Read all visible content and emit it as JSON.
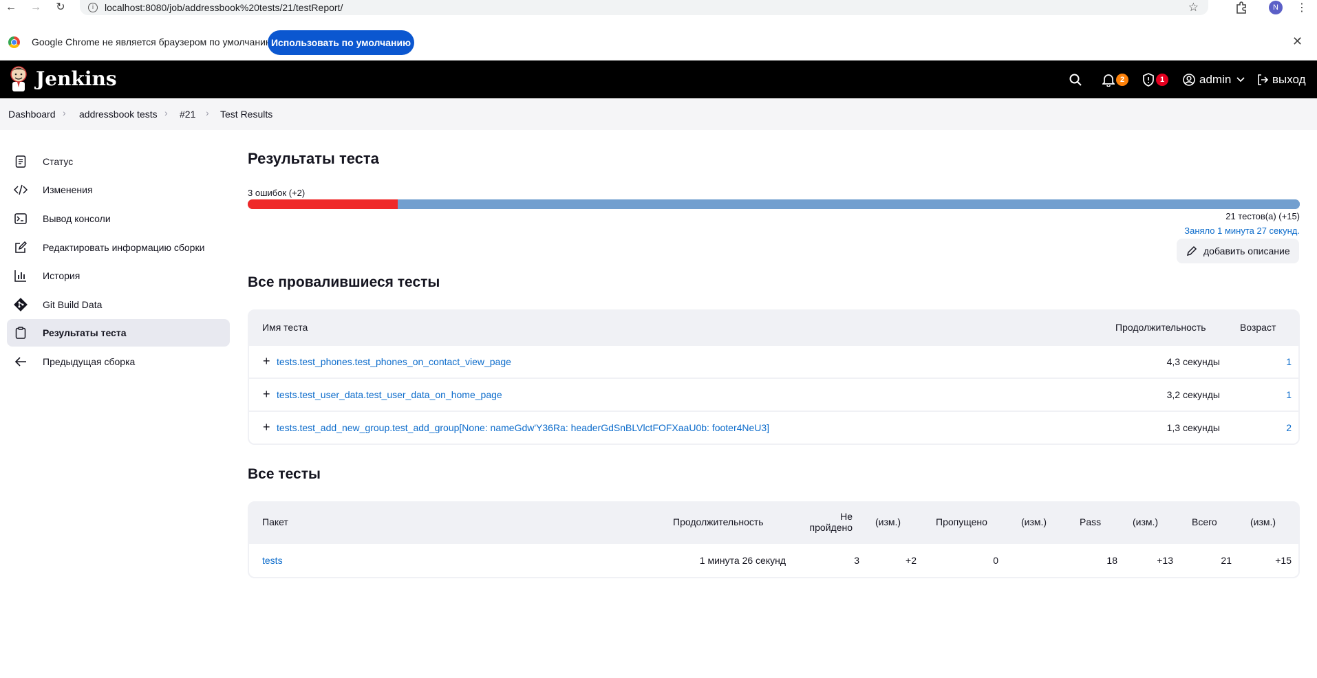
{
  "browser": {
    "url": "localhost:8080/job/addressbook%20tests/21/testReport/",
    "profile_initial": "N"
  },
  "infobar": {
    "message": "Google Chrome не является браузером по умолчанию.",
    "button_label": "Использовать по умолчанию"
  },
  "header": {
    "brand": "Jenkins",
    "notifications_count": "2",
    "security_count": "1",
    "user": "admin",
    "logout_label": "выход"
  },
  "breadcrumb": [
    "Dashboard",
    "addressbook tests",
    "#21",
    "Test Results"
  ],
  "sidebar": {
    "items": [
      {
        "label": "Статус",
        "icon": "document-icon"
      },
      {
        "label": "Изменения",
        "icon": "code-icon"
      },
      {
        "label": "Вывод консоли",
        "icon": "terminal-icon"
      },
      {
        "label": "Редактировать информацию сборки",
        "icon": "edit-icon"
      },
      {
        "label": "История",
        "icon": "chart-icon"
      },
      {
        "label": "Git Build Data",
        "icon": "git-icon"
      },
      {
        "label": "Результаты теста",
        "icon": "clipboard-icon"
      },
      {
        "label": "Предыдущая сборка",
        "icon": "arrow-left-icon"
      }
    ],
    "active_index": 6
  },
  "main": {
    "title": "Результаты теста",
    "failures_label": "3 ошибок (+2)",
    "tests_label": "21 тестов(а) (+15)",
    "took_label": "Заняло 1 минута 27 секунд.",
    "add_description_label": "добавить описание",
    "fail_count": 3,
    "total_count": 21,
    "failed_section_title": "Все провалившиеся тесты",
    "failed_table": {
      "headers": [
        "Имя теста",
        "Продолжительность",
        "Возраст"
      ],
      "rows": [
        {
          "name": "tests.test_phones.test_phones_on_contact_view_page",
          "duration": "4,3 секунды",
          "age": "1"
        },
        {
          "name": "tests.test_user_data.test_user_data_on_home_page",
          "duration": "3,2 секунды",
          "age": "1"
        },
        {
          "name": "tests.test_add_new_group.test_add_group[None: nameGdw'Y36Ra: headerGdSnBLVlctFOFXaaU0b: footer4NeU3]",
          "duration": "1,3 секунды",
          "age": "2"
        }
      ]
    },
    "all_section_title": "Все тесты",
    "all_table": {
      "headers": {
        "package": "Пакет",
        "duration": "Продолжительность",
        "failed_1": "Не",
        "failed_2": "пройдено",
        "diff1": "(изм.)",
        "skipped": "Пропущено",
        "diff2": "(изм.)",
        "pass": "Pass",
        "diff3": "(изм.)",
        "total": "Всего",
        "diff4": "(изм.)"
      },
      "row": {
        "package": "tests",
        "duration": "1 минута 26 секунд",
        "failed": "3",
        "failed_diff": "+2",
        "skipped": "0",
        "skipped_diff": "",
        "pass": "18",
        "pass_diff": "+13",
        "total": "21",
        "total_diff": "+15"
      }
    }
  }
}
